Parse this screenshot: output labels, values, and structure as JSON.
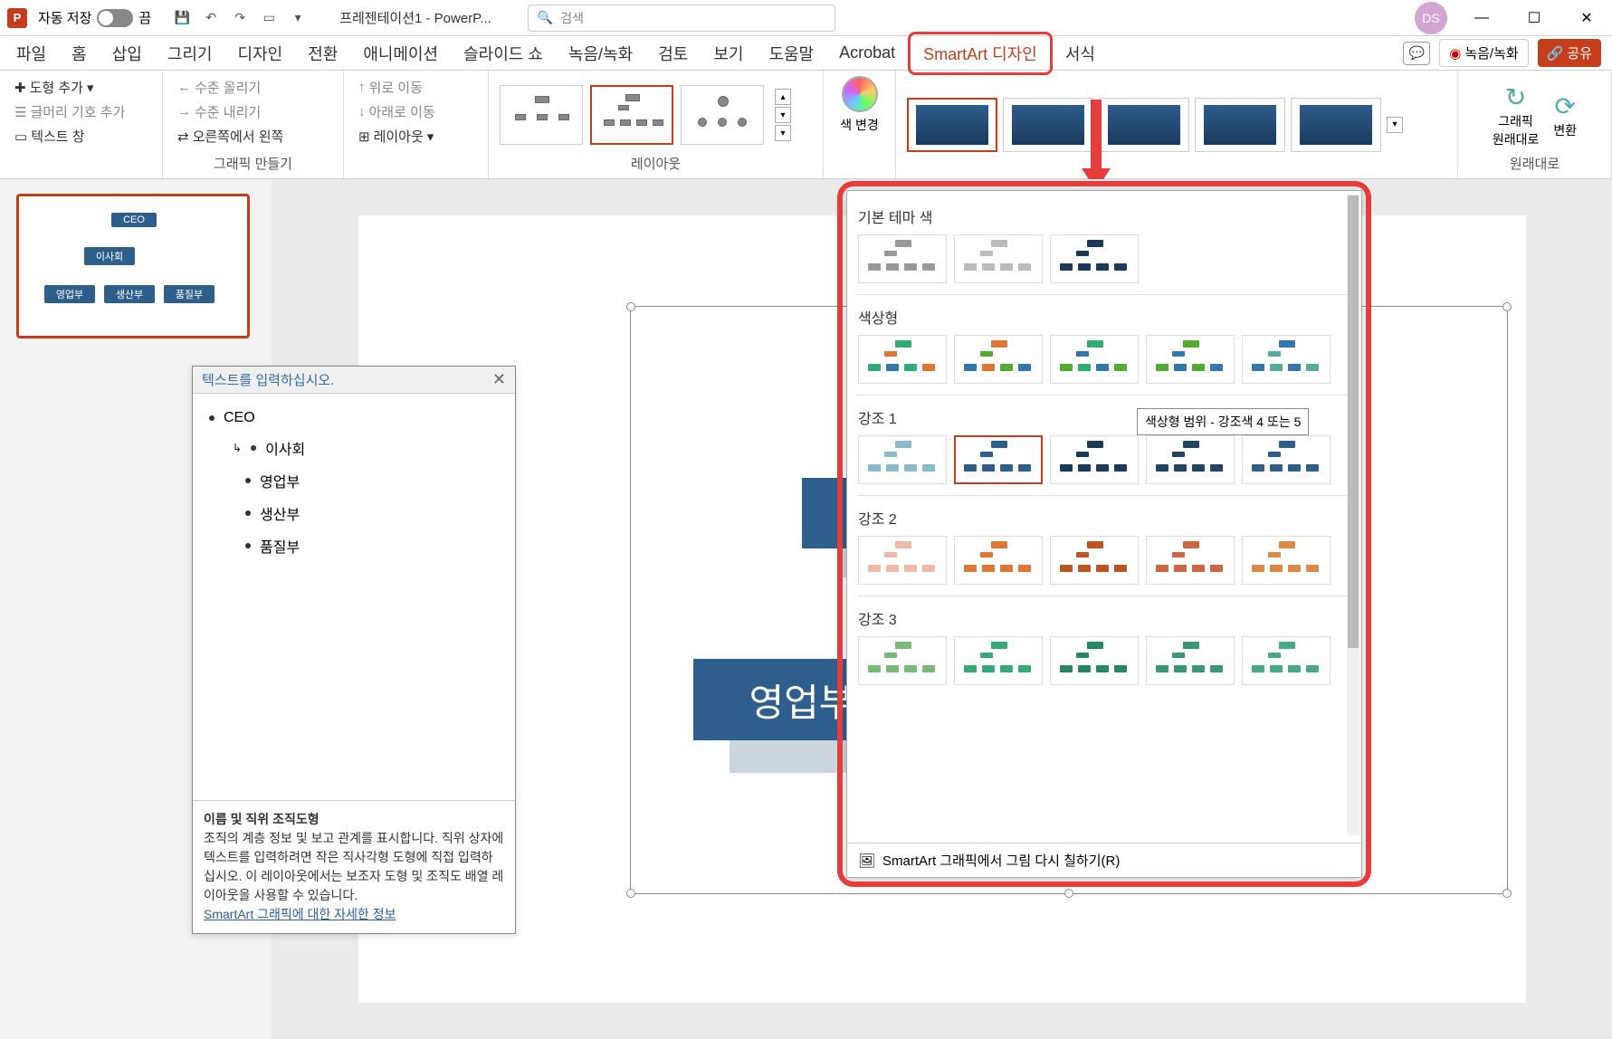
{
  "titlebar": {
    "autosave_label": "자동 저장",
    "autosave_state": "끔",
    "title": "프레젠테이션1 - PowerP...",
    "search_placeholder": "검색",
    "user_initials": "DS"
  },
  "tabs": {
    "file": "파일",
    "home": "홈",
    "insert": "삽입",
    "draw": "그리기",
    "design": "디자인",
    "transition": "전환",
    "animation": "애니메이션",
    "slideshow": "슬라이드 쇼",
    "record": "녹음/녹화",
    "review": "검토",
    "view": "보기",
    "help": "도움말",
    "acrobat": "Acrobat",
    "smartart_design": "SmartArt 디자인",
    "format": "서식",
    "record_btn": "녹음/녹화",
    "share": "공유"
  },
  "ribbon": {
    "add_shape": "도형 추가",
    "add_bullet": "글머리 기호 추가",
    "text_pane": "텍스트 창",
    "level_up": "수준 올리기",
    "level_down": "수준 내리기",
    "right_to_left": "오른쪽에서 왼쪽",
    "move_up": "위로 이동",
    "move_down": "아래로 이동",
    "layout_btn": "레이아웃",
    "group_graphic": "그래픽 만들기",
    "group_layout": "레이아웃",
    "change_colors": "색 변경",
    "reset_graphic": "그래픽\n원래대로",
    "convert": "변환",
    "group_reset": "원래대로"
  },
  "color_gallery": {
    "section_basic": "기본 테마 색",
    "section_colorful": "색상형",
    "section_accent1": "강조 1",
    "section_accent2": "강조 2",
    "section_accent3": "강조 3",
    "footer": "SmartArt 그래픽에서 그림 다시 칠하기(R)",
    "tooltip": "색상형 범위 - 강조색 4 또는 5"
  },
  "text_pane": {
    "header": "텍스트를 입력하십시오.",
    "items": [
      "CEO",
      "이사회",
      "영업부",
      "생산부",
      "품질부"
    ],
    "footer_title": "이름 및 직위 조직도형",
    "footer_body": "조직의 계층 정보 및 보고 관계를 표시합니다. 직위 상자에 텍스트를 입력하려면 작은 직사각형 도형에 직접 입력하십시오. 이 레이아웃에서는 보조자 도형 및 조직도 배열 레이아웃을 사용할 수 있습니다.",
    "footer_link": "SmartArt 그래픽에 대한 자세한 정보"
  },
  "org": {
    "ceo": "CEO",
    "board": "이사회",
    "sales": "영업부",
    "prod": "생산부",
    "quality": "품질부",
    "board_trunc": "이사",
    "sales_big": "영업부"
  }
}
